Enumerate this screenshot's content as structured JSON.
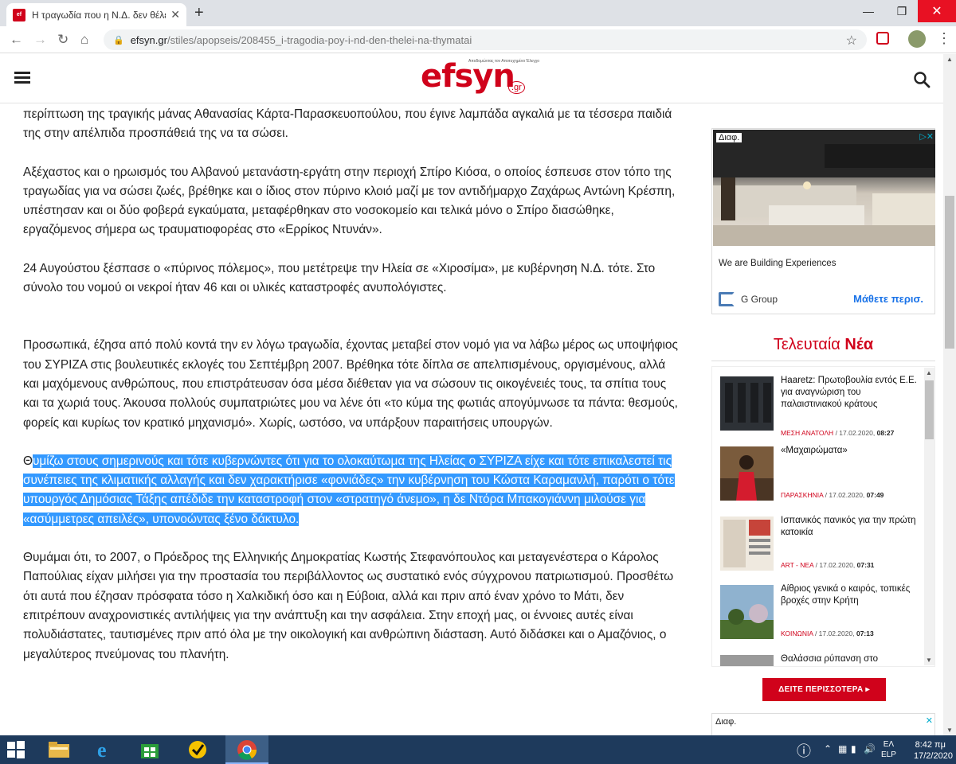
{
  "browser": {
    "tab_title": "Η τραγωδία που η Ν.Δ. δεν θέλει...",
    "tab_close": "✕",
    "new_tab": "+",
    "url_host": "efsyn.gr",
    "url_path": "/stiles/apopseis/208455_i-tragodia-poy-i-nd-den-thelei-na-thymatai"
  },
  "site": {
    "logo_main": "efsyn",
    "logo_suffix": ".gr",
    "logo_tagline": "Αποδομώντας τον Αποτυχημένο Έλεγχο"
  },
  "article": {
    "p1": "περίπτωση της τραγικής μάνας Αθανασίας Κάρτα-Παρασκευοπούλου, που έγινε λαμπάδα αγκαλιά με τα τέσσερα παιδιά της στην απέλπιδα προσπάθειά της να τα σώσει.",
    "p2": "Αξέχαστος και ο ηρωισμός του Αλβανού μετανάστη-εργάτη στην περιοχή Σπίρο Κιόσα, ο οποίος έσπευσε στον τόπο της τραγωδίας για να σώσει ζωές, βρέθηκε και ο ίδιος στον πύρινο κλοιό μαζί με τον αντιδήμαρχο Ζαχάρως Αντώνη Κρέσπη, υπέστησαν και οι δύο φοβερά εγκαύματα, μεταφέρθηκαν στο νοσοκομείο και τελικά μόνο ο Σπίρο διασώθηκε, εργαζόμενος σήμερα ως τραυματιοφορέας στο «Ερρίκος Ντυνάν».",
    "p3": "24 Αυγούστου ξέσπασε ο «πύρινος πόλεμος», που μετέτρεψε την Ηλεία σε «Χιροσίμα», με κυβέρνηση Ν.Δ. τότε. Στο σύνολο του νομού οι νεκροί ήταν 46 και οι υλικές καταστροφές ανυπολόγιστες.",
    "p4": "Προσωπικά, έζησα από πολύ κοντά την εν λόγω τραγωδία, έχοντας μεταβεί στον νομό για να λάβω μέρος ως υποψήφιος του ΣΥΡΙΖΑ στις βουλευτικές εκλογές του Σεπτέμβρη 2007. Βρέθηκα τότε δίπλα σε απελπισμένους, οργισμένους, αλλά και μαχόμενους ανθρώπους, που επιστράτευσαν όσα μέσα διέθεταν για να σώσουν τις οικογένειές τους, τα σπίτια τους και τα χωριά τους. Άκουσα πολλούς συμπατριώτες μου να λένε ότι «το κύμα της φωτιάς απογύμνωσε τα πάντα: θεσμούς, φορείς και κυρίως τον κρατικό μηχανισμό». Χωρίς, ωστόσο, να υπάρξουν παραιτήσεις υπουργών.",
    "p5_first": "Θ",
    "p5_rest": "υμίζω στους σημερινούς και τότε κυβερνώντες ότι για το ολοκαύτωμα της Ηλείας ο ΣΥΡΙΖΑ είχε και τότε επικαλεστεί τις συνέπειες της κλιματικής αλλαγής και δεν χαρακτήρισε «φονιάδες» την κυβέρνηση του Κώστα Καραμανλή, παρότι ο τότε υπουργός Δημόσιας Τάξης απέδιδε την καταστροφή στον «στρατηγό άνεμο», η δε Ντόρα Μπακογιάννη μιλούσε για «ασύμμετρες απειλές», υπονοώντας ξένο δάκτυλο.",
    "p6": "Θυμάμαι ότι, το 2007, ο Πρόεδρος της Ελληνικής Δημοκρατίας Κωστής Στεφανόπουλος και μεταγενέστερα ο Κάρολος Παπούλιας είχαν μιλήσει για την προστασία του περιβάλλοντος ως συστατικό ενός σύγχρονου πατριωτισμού. Προσθέτω ότι αυτά που έζησαν πρόσφατα τόσο η Χαλκιδική όσο και η Εύβοια, αλλά και πριν από έναν χρόνο το Μάτι, δεν επιτρέπουν αναχρονιστικές αντιλήψεις για την ανάπτυξη και την ασφάλεια. Στην εποχή μας, οι έννοιες αυτές είναι πολυδιάστατες, ταυτισμένες πριν από όλα με την οικολογική και ανθρώπινη διάσταση. Αυτό διδάσκει και ο Αμαζόνιος, ο μεγαλύτερος πνεύμονας του πλανήτη."
  },
  "ad1": {
    "label": "Διαφ.",
    "text": "We are Building Experiences",
    "brand": "G Group",
    "cta": "Μάθετε περισ."
  },
  "latest": {
    "head_light": "Τελευταία",
    "head_bold": "Νέα",
    "items": [
      {
        "title": "Haaretz: Πρωτοβουλία εντός Ε.Ε. για αναγνώριση του παλαιστινιακού κράτους",
        "category": "ΜΕΣΗ ΑΝΑΤΟΛΗ",
        "date": "/ 17.02.2020,",
        "time": "08:27"
      },
      {
        "title": "«Μαχαιρώματα»",
        "category": "ΠΑΡΑΣΚΗΝΙΑ",
        "date": "/ 17.02.2020,",
        "time": "07:49"
      },
      {
        "title": "Ισπανικός πανικός για την πρώτη κατοικία",
        "category": "ART - ΝΕΑ",
        "date": "/ 17.02.2020,",
        "time": "07:31"
      },
      {
        "title": "Αίθριος γενικά ο καιρός, τοπικές βροχές στην Κρήτη",
        "category": "ΚΟΙΝΩΝΙΑ",
        "date": "/ 17.02.2020,",
        "time": "07:13"
      },
      {
        "title": "Θαλάσσια ρύπανση στο",
        "category": "",
        "date": "",
        "time": ""
      }
    ],
    "more_button": "ΔΕΙΤΕ ΠΕΡΙΣΣΟΤΕΡΑ ▸"
  },
  "ad2": {
    "label": "Διαφ."
  },
  "taskbar": {
    "lang_top": "ΕΛ",
    "lang_bottom": "ELP",
    "time": "8:42 πμ",
    "date": "17/2/2020"
  }
}
